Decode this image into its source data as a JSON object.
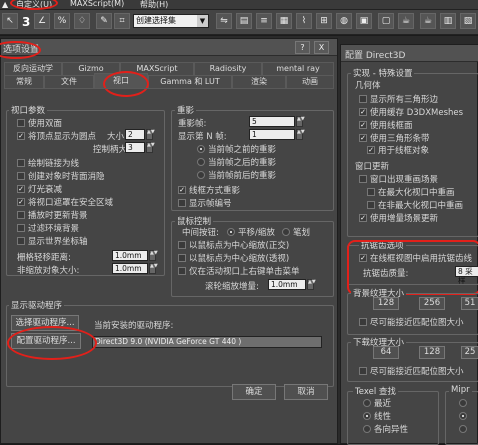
{
  "menubar": {
    "items": [
      "自定义(U)",
      "MAXScript(M)",
      "帮助(H)"
    ]
  },
  "toolbar": {
    "number": "3",
    "selection_set": "创建选择集",
    "colors": {
      "bg": "#444444"
    }
  },
  "pref": {
    "title": "选项设置",
    "help": "?",
    "close": "X",
    "tabs_top": [
      "反向运动学",
      "Gizmo",
      "MAXScript",
      "Radiosity",
      "mental ray"
    ],
    "tabs_bottom": [
      "常规",
      "文件",
      "视口",
      "Gamma 和 LUT",
      "渲染",
      "动画"
    ],
    "viewport_params": {
      "title": "视口参数",
      "items": [
        {
          "label": "使用双面",
          "checked": false
        },
        {
          "label": "将顶点显示为圆点",
          "checked": true
        },
        {
          "label": "绘制链接为线",
          "checked": false
        },
        {
          "label": "创建对象时背面消隐",
          "checked": false
        },
        {
          "label": "灯光衰减",
          "checked": true
        },
        {
          "label": "将视口遮罩在安全区域",
          "checked": true
        },
        {
          "label": "播放时更新背景",
          "checked": false
        },
        {
          "label": "过滤环境背景",
          "checked": false
        },
        {
          "label": "显示世界坐标轴",
          "checked": false
        }
      ],
      "size_label": "大小",
      "size_value": "2",
      "handle_label": "控制柄大小",
      "handle_value": "3",
      "grid_nudge_label": "栅格轻移距离:",
      "grid_nudge_value": "1.0mm",
      "non_scale_label": "非缩放对象大小:",
      "non_scale_value": "1.0mm"
    },
    "ghosting": {
      "title": "重影",
      "frames_label": "重影帧:",
      "frames_value": "5",
      "every_n_label": "显示第 N 帧:",
      "every_n_value": "1",
      "options": [
        {
          "label": "当前帧之前的重影",
          "selected": true
        },
        {
          "label": "当前帧之后的重影",
          "selected": false
        },
        {
          "label": "当前帧前后的重影",
          "selected": false
        }
      ],
      "checks": [
        {
          "label": "线框方式重影",
          "checked": true
        },
        {
          "label": "显示帧编号",
          "checked": false
        }
      ]
    },
    "mouse": {
      "title": "鼠标控制",
      "middle_label": "中间按钮:",
      "middle_opts": [
        {
          "label": "平移/缩放",
          "selected": true
        },
        {
          "label": "笔划",
          "selected": false
        }
      ],
      "checks": [
        {
          "label": "以鼠标点为中心缩放(正交)",
          "checked": false
        },
        {
          "label": "以鼠标点为中心缩放(透视)",
          "checked": false
        },
        {
          "label": "仅在活动视口上右键单击菜单",
          "checked": false
        }
      ],
      "wheel_label": "滚轮缩放增量:",
      "wheel_value": "1.0mm"
    },
    "driver": {
      "title": "显示驱动程序",
      "choose_button": "选择驱动程序...",
      "current_label": "当前安装的驱动程序:",
      "config_button": "配置驱动程序...",
      "current_value": "Direct3D 9.0 (NVIDIA GeForce GT 440 )"
    },
    "ok": "确定",
    "cancel": "取消"
  },
  "d3d": {
    "title": "配置 Direct3D",
    "impl": {
      "title": "实现 - 特殊设置",
      "geom_title": "几何体",
      "items": [
        {
          "label": "显示所有三角形边",
          "checked": false
        },
        {
          "label": "使用缓存 D3DXMeshes",
          "checked": true
        },
        {
          "label": "使用线框面",
          "checked": true
        },
        {
          "label": "使用三角形条带",
          "checked": true
        },
        {
          "label": "用于线框对象",
          "checked": true
        }
      ],
      "win_title": "窗口更新",
      "win_items": [
        {
          "label": "窗口出现重画场景",
          "checked": false
        },
        {
          "label": "在最大化视口中重画",
          "checked": false
        },
        {
          "label": "在非最大化视口中重画",
          "checked": false
        },
        {
          "label": "使用增量场景更新",
          "checked": true
        }
      ]
    },
    "aa": {
      "title": "抗锯齿选项",
      "check_label": "在线框视图中启用抗锯齿线",
      "checked": true,
      "quality_label": "抗锯齿质量:",
      "quality_value": "8 采样"
    },
    "bg_tex": {
      "title": "背景纹理大小",
      "sizes": [
        "128",
        "256",
        "51"
      ],
      "check_label": "尽可能接近匹配位图大小"
    },
    "dl_tex": {
      "title": "下载纹理大小",
      "sizes": [
        "64",
        "128",
        "25"
      ],
      "check_label": "尽可能接近匹配位图大小"
    },
    "texel": {
      "title": "Texel 查找",
      "options": [
        {
          "label": "最近",
          "selected": false
        },
        {
          "label": "线性",
          "selected": true
        },
        {
          "label": "各向异性",
          "selected": false
        }
      ]
    },
    "mip": {
      "title": "Mipr"
    }
  }
}
